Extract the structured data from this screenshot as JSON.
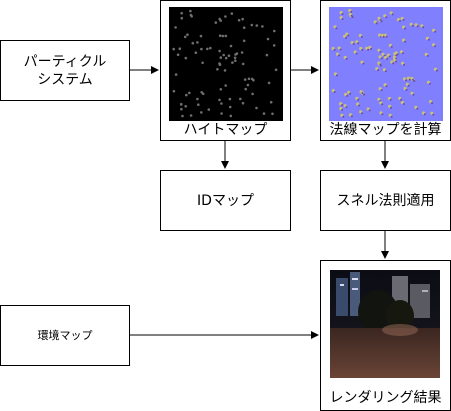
{
  "nodes": {
    "particle_system": "パーティクル\nシステム",
    "height_map": "ハイトマップ",
    "normal_map_calc": "法線マップを計算",
    "id_map": "IDマップ",
    "screen_normal": "スネル法則適用",
    "env_map": "環境マップ",
    "render_result": "レンダリング結果"
  },
  "colors": {
    "heightmap_bg": "#000000",
    "heightmap_dot": "#6e6e6e",
    "normalmap_bg": "#8080ff",
    "normalmap_dot": "#a0a070",
    "render_sky": "#0e0f18",
    "render_ground": "#5a3a30"
  }
}
